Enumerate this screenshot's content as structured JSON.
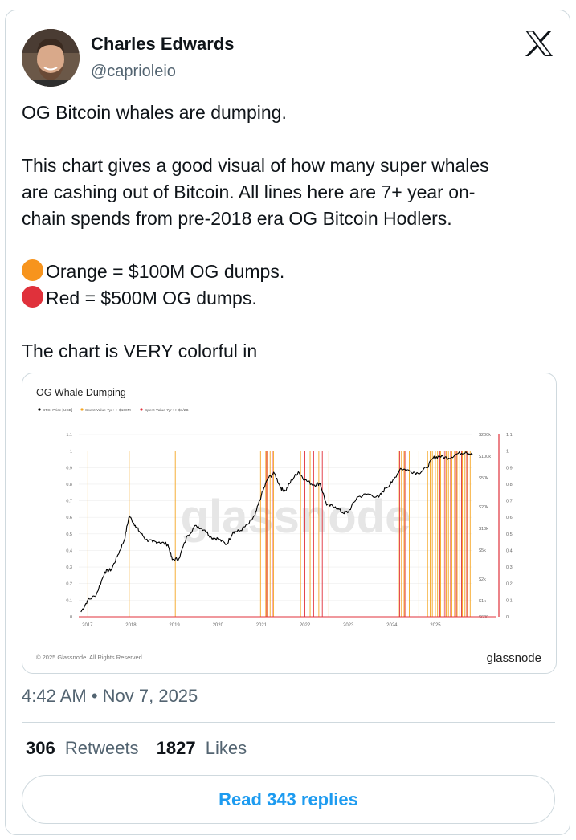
{
  "author": {
    "name": "Charles Edwards",
    "handle": "@caprioleio"
  },
  "tweet": {
    "line1": "OG Bitcoin whales are dumping.",
    "para2_l1": "This chart gives a good visual of how many super whales",
    "para2_l2": "are cashing out of Bitcoin. All lines here are 7+ year on-",
    "para2_l3": "chain spends from pre-2018 era OG Bitcoin Hodlers.",
    "orange_line": "Orange = $100M OG dumps.",
    "red_line": "Red = $500M OG dumps.",
    "last_line": "The chart is VERY colorful in"
  },
  "colors": {
    "orange": "#f5a623",
    "red": "#e0313b",
    "link": "#1d9bf0",
    "muted": "#536471",
    "border": "#cfd9de"
  },
  "icons": {
    "brand": "x-logo-icon",
    "orange": "orange-circle-icon",
    "red": "red-circle-icon"
  },
  "timestamp": "4:42 AM • Nov 7, 2025",
  "stats": {
    "retweets_count": "306",
    "retweets_label": "Retweets",
    "likes_count": "1827",
    "likes_label": "Likes"
  },
  "read_replies": "Read 343 replies",
  "chart_data": {
    "type": "line",
    "title": "OG Whale Dumping",
    "legend": [
      "BTC: Price [USD]",
      "Spent Value 7yr+ > $100M",
      "Spent Value 7yr+ > $1/2B"
    ],
    "watermark": "glassnode",
    "footer_left": "© 2025 Glassnode. All Rights Reserved.",
    "footer_brand": "glassnode",
    "x_ticks": [
      "2017",
      "2018",
      "2019",
      "2020",
      "2021",
      "2022",
      "2023",
      "2024",
      "2025"
    ],
    "x_tick_values": [
      2017.0,
      2018.0,
      2019.0,
      2020.0,
      2021.0,
      2022.0,
      2023.0,
      2024.0,
      2025.0
    ],
    "xlim": [
      2016.8,
      2025.85
    ],
    "left_ticks": [
      "0",
      "0.1",
      "0.2",
      "0.3",
      "0.4",
      "0.5",
      "0.6",
      "0.7",
      "0.8",
      "0.9",
      "1",
      "1.1"
    ],
    "right_inner_ticks": [
      "$600",
      "$1k",
      "$2k",
      "$5k",
      "$10k",
      "$20k",
      "$50k",
      "$100k",
      "$200k"
    ],
    "right_inner_values": [
      600,
      1000,
      2000,
      5000,
      10000,
      20000,
      50000,
      100000,
      200000
    ],
    "right_outer_ticks": [
      "0",
      "0.1",
      "0.2",
      "0.3",
      "0.4",
      "0.5",
      "0.6",
      "0.7",
      "0.8",
      "0.9",
      "1",
      "1.1"
    ],
    "y_log": true,
    "ylim": [
      600,
      200000
    ],
    "series": [
      {
        "name": "BTC: Price [USD]",
        "x": [
          2016.85,
          2017.0,
          2017.2,
          2017.4,
          2017.55,
          2017.7,
          2017.85,
          2017.96,
          2018.1,
          2018.2,
          2018.35,
          2018.5,
          2018.65,
          2018.85,
          2018.95,
          2019.1,
          2019.3,
          2019.5,
          2019.7,
          2019.85,
          2020.0,
          2020.2,
          2020.35,
          2020.5,
          2020.7,
          2020.85,
          2021.0,
          2021.15,
          2021.3,
          2021.45,
          2021.55,
          2021.7,
          2021.85,
          2022.0,
          2022.2,
          2022.35,
          2022.5,
          2022.7,
          2022.87,
          2023.0,
          2023.2,
          2023.45,
          2023.7,
          2023.85,
          2024.0,
          2024.2,
          2024.4,
          2024.6,
          2024.8,
          2024.95,
          2025.1,
          2025.3,
          2025.5,
          2025.7,
          2025.85
        ],
        "y": [
          700,
          1000,
          1200,
          2500,
          2700,
          4300,
          7000,
          15000,
          11000,
          9000,
          7000,
          6500,
          6500,
          6000,
          3700,
          3800,
          8000,
          11000,
          9500,
          7500,
          7200,
          6000,
          9000,
          9200,
          11500,
          15000,
          29000,
          50000,
          58000,
          36000,
          33000,
          47000,
          61000,
          47000,
          40000,
          42000,
          21000,
          20000,
          16500,
          17000,
          27000,
          30000,
          27000,
          36000,
          43000,
          68000,
          63000,
          58000,
          69000,
          95000,
          100000,
          94000,
          108000,
          115000,
          105000
        ]
      }
    ],
    "orange_events": [
      2017.01,
      2017.96,
      2019.02,
      2020.98,
      2021.1,
      2021.14,
      2021.2,
      2021.28,
      2021.9,
      2022.12,
      2022.32,
      2022.55,
      2023.2,
      2024.15,
      2024.22,
      2024.28,
      2024.4,
      2024.62,
      2024.82,
      2024.88,
      2024.93,
      2025.0,
      2025.05,
      2025.12,
      2025.18,
      2025.25,
      2025.3,
      2025.38,
      2025.44,
      2025.5,
      2025.56,
      2025.62,
      2025.68,
      2025.74,
      2025.8
    ],
    "red_events": [
      2021.12,
      2021.25,
      2022.0,
      2022.2,
      2022.4,
      2024.18,
      2024.3,
      2024.9,
      2025.1,
      2025.22,
      2025.35,
      2025.48,
      2025.6,
      2025.72
    ]
  }
}
